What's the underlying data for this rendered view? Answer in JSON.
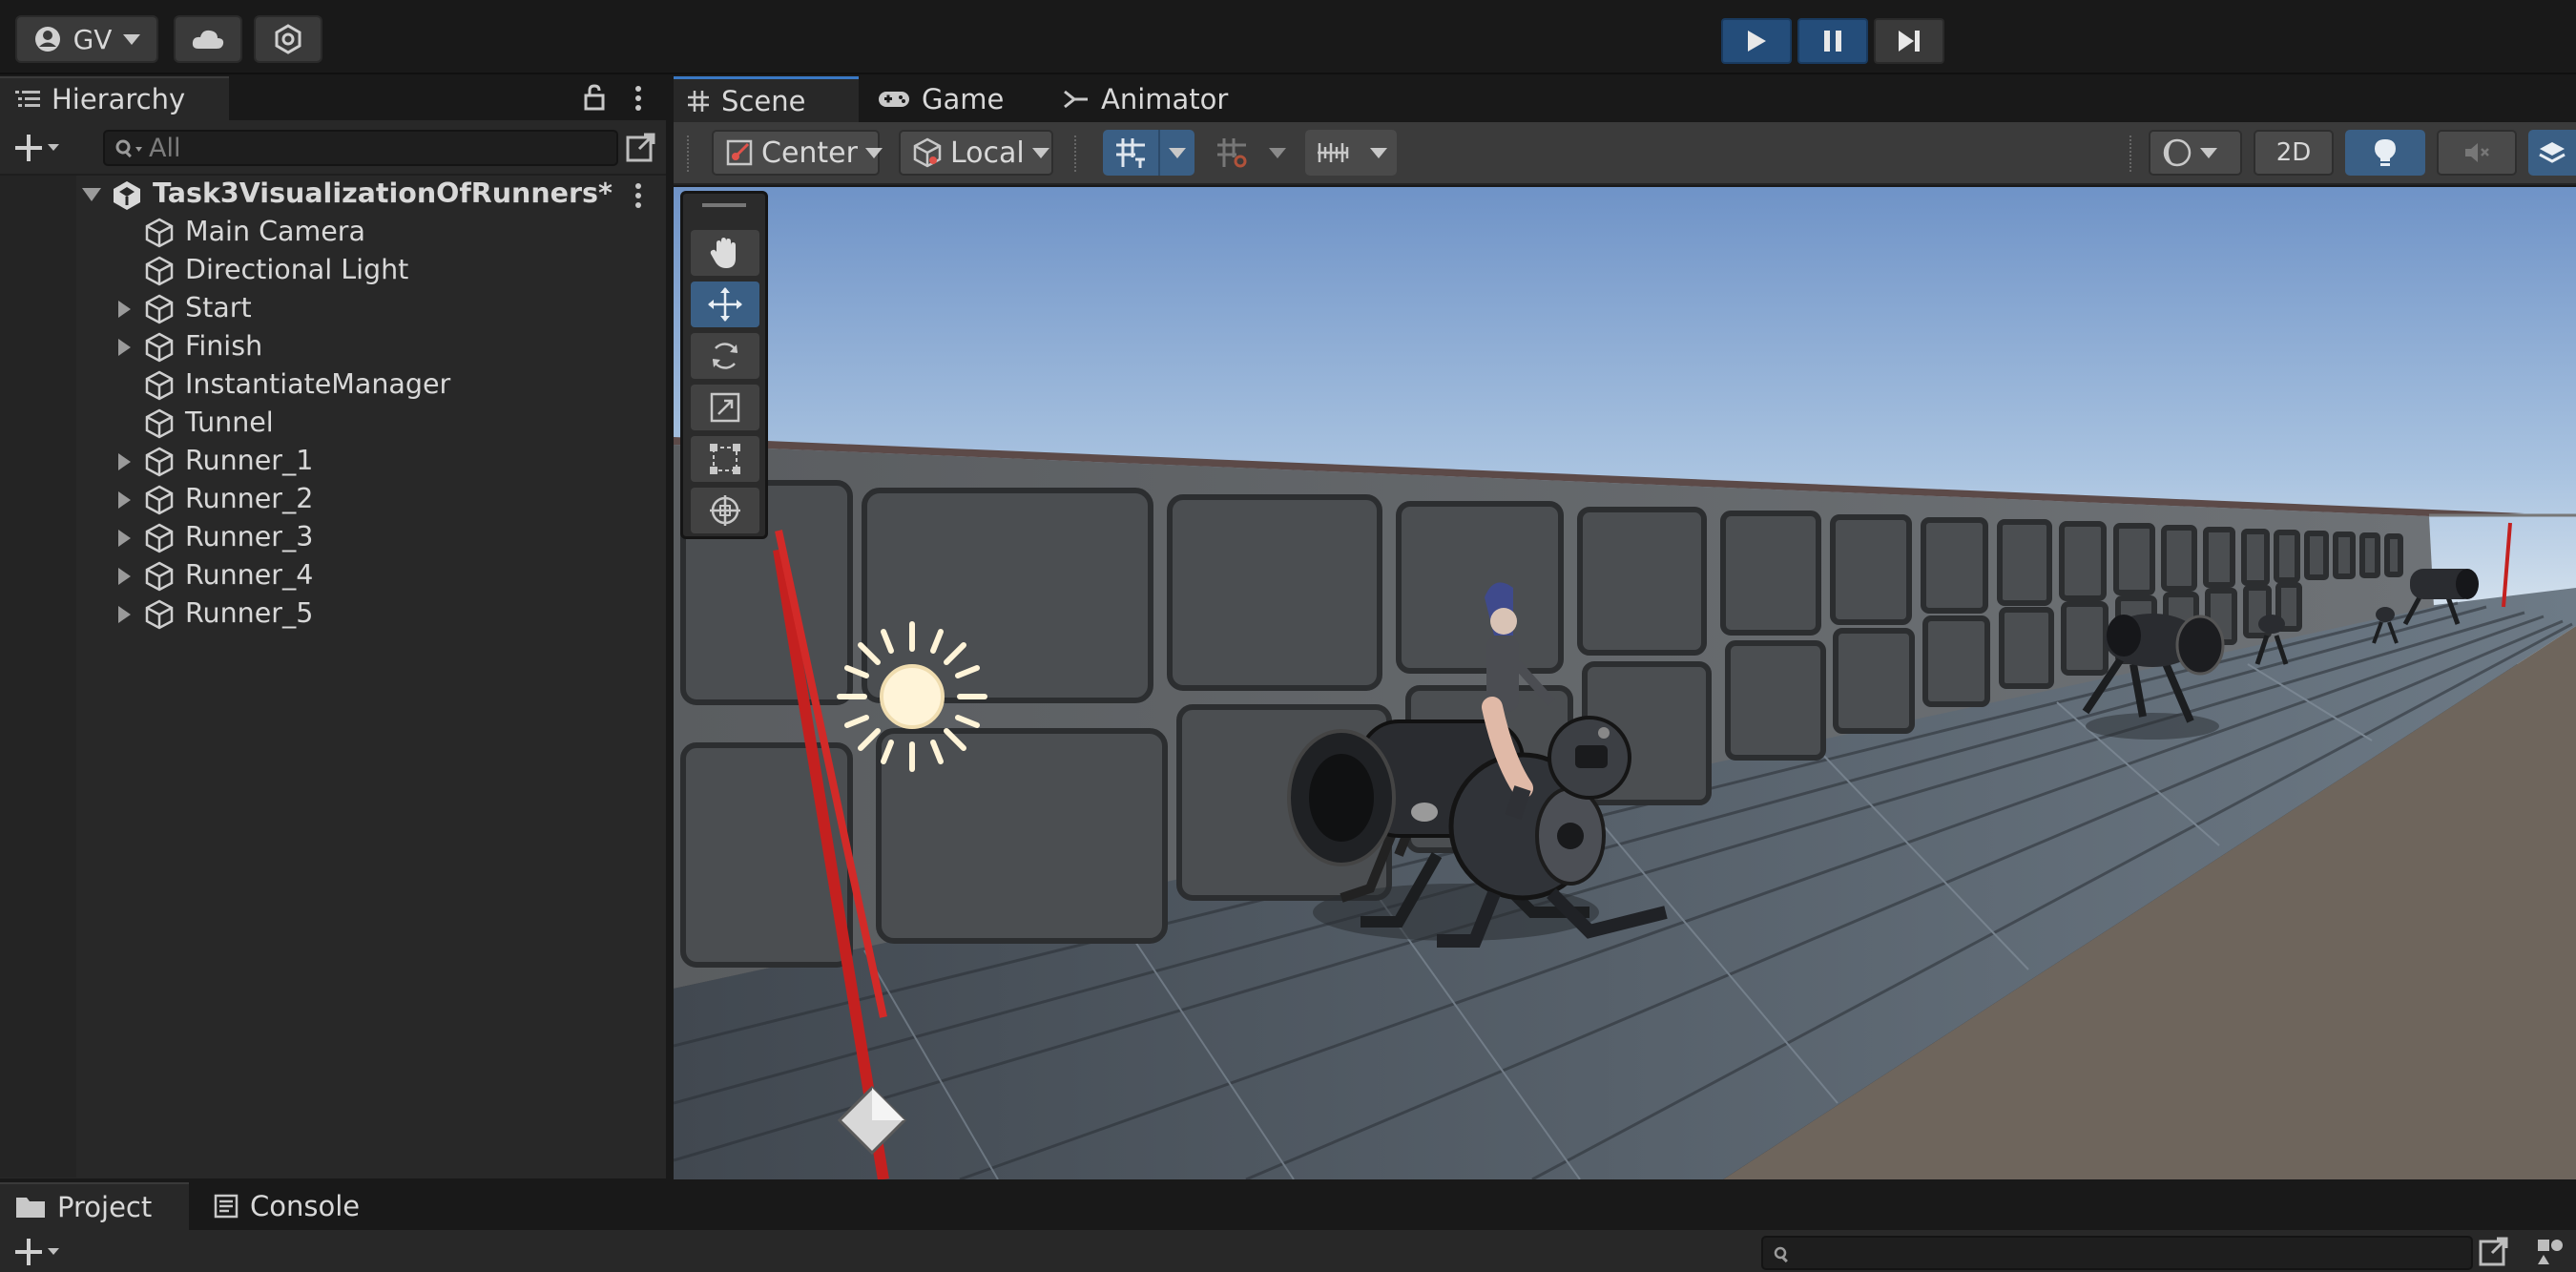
{
  "topbar": {
    "account_label": "GV",
    "play_icon": "play-icon",
    "pause_icon": "pause-icon",
    "step_icon": "step-icon"
  },
  "hierarchy": {
    "tab_label": "Hierarchy",
    "search_placeholder": "All",
    "scene_name": "Task3VisualizationOfRunners*",
    "items": [
      {
        "label": "Main Camera",
        "has_children": false
      },
      {
        "label": "Directional Light",
        "has_children": false
      },
      {
        "label": "Start",
        "has_children": true
      },
      {
        "label": "Finish",
        "has_children": true
      },
      {
        "label": "InstantiateManager",
        "has_children": false
      },
      {
        "label": "Tunnel",
        "has_children": false
      },
      {
        "label": "Runner_1",
        "has_children": true
      },
      {
        "label": "Runner_2",
        "has_children": true
      },
      {
        "label": "Runner_3",
        "has_children": true
      },
      {
        "label": "Runner_4",
        "has_children": true
      },
      {
        "label": "Runner_5",
        "has_children": true
      }
    ]
  },
  "scene_tabs": {
    "scene": "Scene",
    "game": "Game",
    "animator": "Animator"
  },
  "scene_toolbar": {
    "pivot": "Center",
    "space": "Local",
    "mode_2d": "2D"
  },
  "bottom": {
    "project_tab": "Project",
    "console_tab": "Console"
  },
  "colors": {
    "accent": "#244d7a",
    "selected_tool": "#3a5f85",
    "sky_top": "#6f93c7",
    "floor": "#6e655c"
  }
}
